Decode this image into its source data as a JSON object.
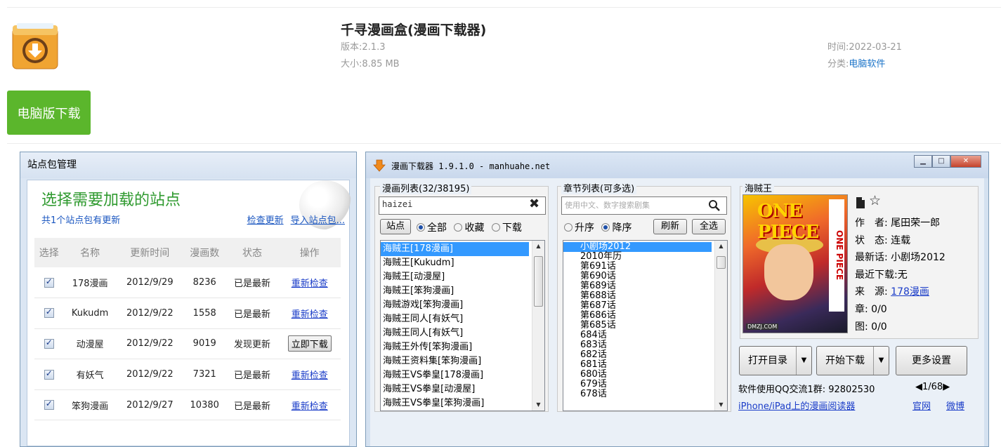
{
  "app": {
    "title": "千寻漫画盒(漫画下载器)",
    "version_label": "版本:",
    "version": "2.1.3",
    "size_label": "大小:",
    "size": "8.85 MB",
    "time_label": "时间:",
    "time": "2022-03-21",
    "category_label": "分类:",
    "category": "电脑软件",
    "download_button": "电脑版下载"
  },
  "site_window": {
    "title": "站点包管理",
    "heading": "选择需要加载的站点",
    "update_note": "共1个站点包有更新",
    "check_update": "检查更新",
    "import_pack": "导入站点包...",
    "columns": [
      "选择",
      "名称",
      "更新时间",
      "漫画数",
      "状态",
      "操作"
    ],
    "rows": [
      {
        "name": "178漫画",
        "date": "2012/9/29",
        "count": "8236",
        "status": "已是最新",
        "status_type": "ok",
        "action": "重新检查",
        "action_type": "link"
      },
      {
        "name": "Kukudm",
        "date": "2012/9/22",
        "count": "1558",
        "status": "已是最新",
        "status_type": "ok",
        "action": "重新检查",
        "action_type": "link"
      },
      {
        "name": "动漫屋",
        "date": "2012/9/22",
        "count": "9019",
        "status": "发现更新",
        "status_type": "new",
        "action": "立即下载",
        "action_type": "button"
      },
      {
        "name": "有妖气",
        "date": "2012/9/22",
        "count": "7321",
        "status": "已是最新",
        "status_type": "ok",
        "action": "重新检查",
        "action_type": "link"
      },
      {
        "name": "笨狗漫画",
        "date": "2012/9/27",
        "count": "10380",
        "status": "已是最新",
        "status_type": "ok",
        "action": "重新检查",
        "action_type": "link"
      }
    ]
  },
  "downloader": {
    "title": "漫画下载器 1.9.1.0 - manhuahe.net",
    "comic_list_label": "漫画列表(32/38195)",
    "search_value": "haizei",
    "site_button": "站点",
    "filter_all": "全部",
    "filter_fav": "收藏",
    "filter_download": "下载",
    "comics": [
      "海贼王[178漫画]",
      "海贼王[Kukudm]",
      "海贼王[动漫屋]",
      "海贼王[笨狗漫画]",
      "海贼游戏[笨狗漫画]",
      "海贼王同人[有妖气]",
      "海贼王同人[有妖气]",
      "海贼王外传[笨狗漫画]",
      "海贼王资料集[笨狗漫画]",
      "海贼王VS拳皇[178漫画]",
      "海贼王VS拳皇[动漫屋]",
      "海贼王VS拳皇[笨狗漫画]"
    ],
    "chapter_list_label": "章节列表(可多选)",
    "chapter_search_placeholder": "使用中文、数字搜索剧集",
    "sort_asc": "升序",
    "sort_desc": "降序",
    "refresh_button": "刷新",
    "select_all_button": "全选",
    "chapters": [
      "小剧场2012",
      "2010年历",
      "第691话",
      "第690话",
      "第689话",
      "第688话",
      "第687话",
      "第686话",
      "第685话",
      "684话",
      "683话",
      "682话",
      "681话",
      "680话",
      "679话",
      "678话"
    ],
    "detail_title": "海贼王",
    "author_label": "作　者:",
    "author": "尾田荣一郎",
    "state_label": "状　态:",
    "state": "连载",
    "latest_label": "最新话:",
    "latest": "小剧场2012",
    "recent_label": "最近下载:",
    "recent": "无",
    "source_label": "来　源:",
    "source": "178漫画",
    "chapter_count_label": "章:",
    "chapter_count": "0/0",
    "image_count_label": "图:",
    "image_count": "0/0",
    "cover_logo": "ONE PIECE",
    "cover_side": "ONE PIECE",
    "cover_tag": "DMZJ.COM",
    "open_dir_button": "打开目录",
    "start_download_button": "开始下载",
    "more_settings_button": "更多设置",
    "qq_group": "软件使用QQ交流1群: 92802530",
    "pager": "1/68",
    "iphone_link": "iPhone/iPad上的漫画阅读器",
    "official_link": "官网",
    "weibo_link": "微博"
  },
  "colors": {
    "download_green": "#5bb62c",
    "link_blue": "#1a73c8",
    "status_ok": "#1e9a1e",
    "status_new": "#f0a020",
    "selection": "#3399ff"
  }
}
